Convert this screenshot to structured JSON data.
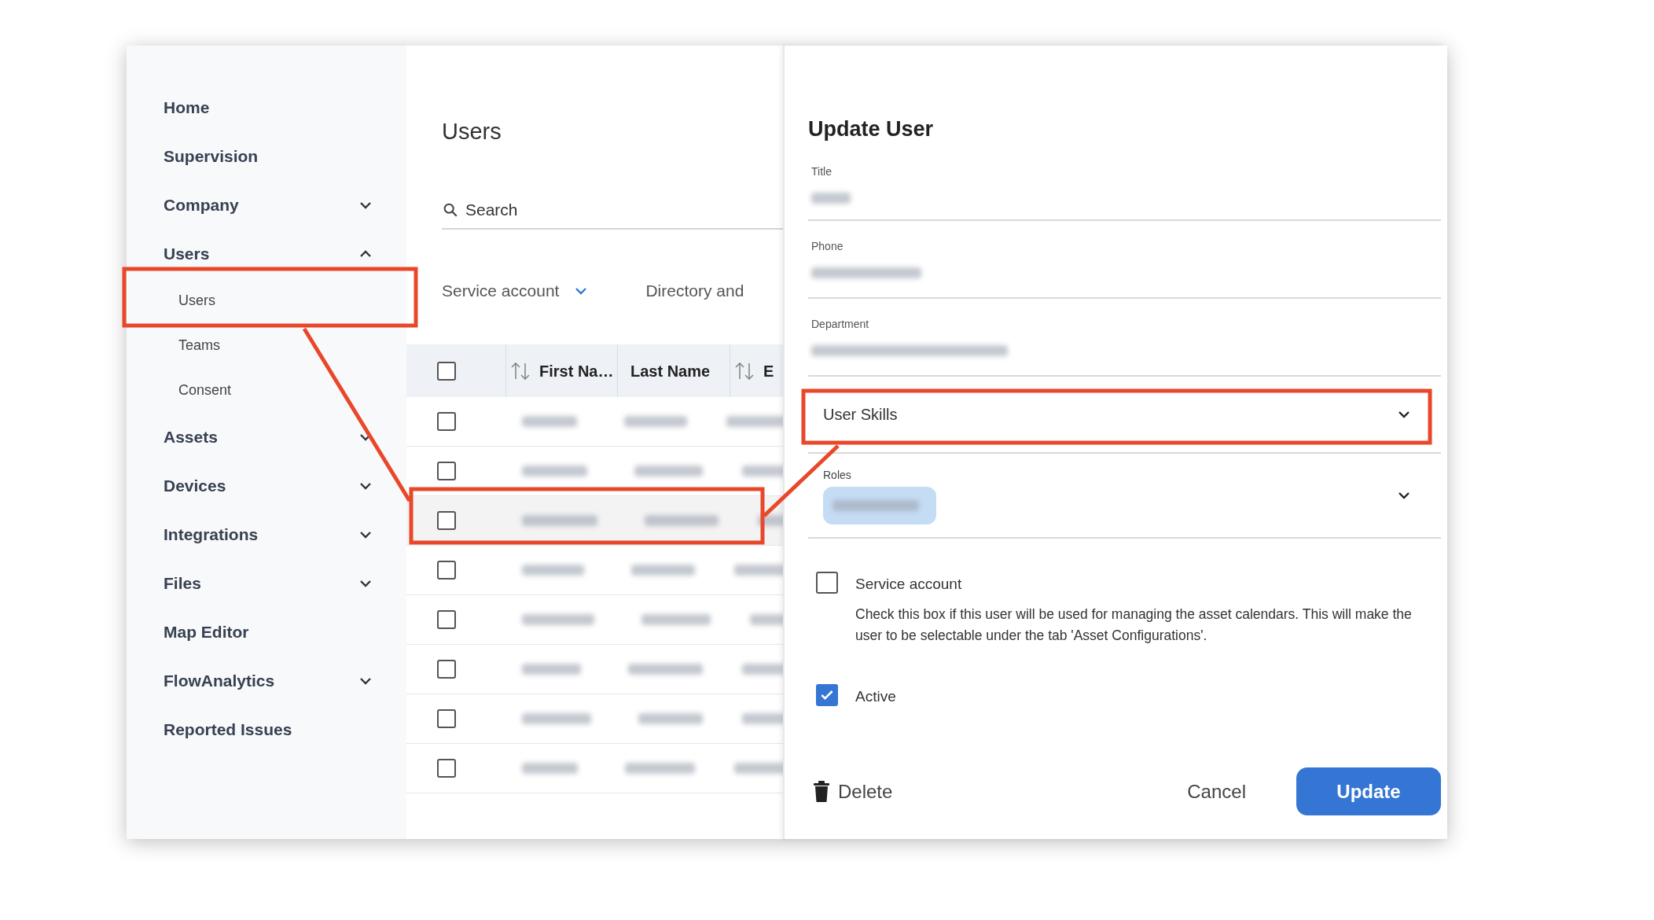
{
  "sidebar": {
    "items": [
      {
        "label": "Home",
        "expandable": false
      },
      {
        "label": "Supervision",
        "expandable": false
      },
      {
        "label": "Company",
        "expandable": true,
        "expanded": false
      },
      {
        "label": "Users",
        "expandable": true,
        "expanded": true,
        "children": [
          {
            "label": "Users"
          },
          {
            "label": "Teams"
          },
          {
            "label": "Consent"
          }
        ]
      },
      {
        "label": "Assets",
        "expandable": true,
        "expanded": false
      },
      {
        "label": "Devices",
        "expandable": true,
        "expanded": false
      },
      {
        "label": "Integrations",
        "expandable": true,
        "expanded": false
      },
      {
        "label": "Files",
        "expandable": true,
        "expanded": false
      },
      {
        "label": "Map Editor",
        "expandable": false
      },
      {
        "label": "FlowAnalytics",
        "expandable": true,
        "expanded": false
      },
      {
        "label": "Reported Issues",
        "expandable": false
      }
    ]
  },
  "main": {
    "title": "Users",
    "search": {
      "placeholder": "Search"
    },
    "filters": [
      {
        "label": "Service account"
      },
      {
        "label": "Directory and"
      }
    ],
    "table": {
      "select_all": {
        "checked": false
      },
      "columns": [
        {
          "label": "First Na…",
          "sortable": true
        },
        {
          "label": "Last Name",
          "sortable": false
        },
        {
          "label": "E",
          "sortable": true
        }
      ],
      "rows": [
        {
          "checked": false,
          "highlighted": false
        },
        {
          "checked": false,
          "highlighted": false
        },
        {
          "checked": false,
          "highlighted": true
        },
        {
          "checked": false,
          "highlighted": false
        },
        {
          "checked": false,
          "highlighted": false
        },
        {
          "checked": false,
          "highlighted": false
        },
        {
          "checked": false,
          "highlighted": false
        },
        {
          "checked": false,
          "highlighted": false
        }
      ]
    }
  },
  "panel": {
    "title": "Update User",
    "fields": [
      {
        "label": "Title"
      },
      {
        "label": "Phone"
      },
      {
        "label": "Department"
      }
    ],
    "user_skills": {
      "label": "User Skills"
    },
    "roles": {
      "label": "Roles"
    },
    "checkboxes": [
      {
        "label": "Service account",
        "checked": false,
        "description": "Check this box if this user will be used for managing the asset calendars. This will make the user to be selectable under the tab 'Asset Configurations'."
      },
      {
        "label": "Active",
        "checked": true
      }
    ],
    "buttons": {
      "delete": "Delete",
      "cancel": "Cancel",
      "update": "Update"
    }
  }
}
